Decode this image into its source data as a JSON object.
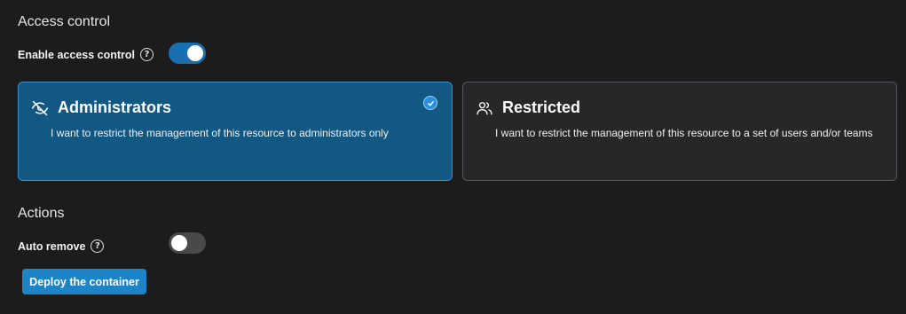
{
  "access_control": {
    "section_title": "Access control",
    "enable_label": "Enable access control",
    "enable_state": "on"
  },
  "options": [
    {
      "title": "Administrators",
      "description": "I want to restrict the management of this resource to administrators only",
      "icon": "eye-slash-icon",
      "selected": true
    },
    {
      "title": "Restricted",
      "description": "I want to restrict the management of this resource to a set of users and/or teams",
      "icon": "users-icon",
      "selected": false
    }
  ],
  "actions": {
    "section_title": "Actions",
    "auto_remove_label": "Auto remove",
    "auto_remove_state": "off"
  },
  "deploy_button": {
    "label": "Deploy the container"
  },
  "colors": {
    "background": "#1c1c1d",
    "accent": "#1d84c8",
    "selected_card": "#125882",
    "unselected_card": "#27272a"
  }
}
